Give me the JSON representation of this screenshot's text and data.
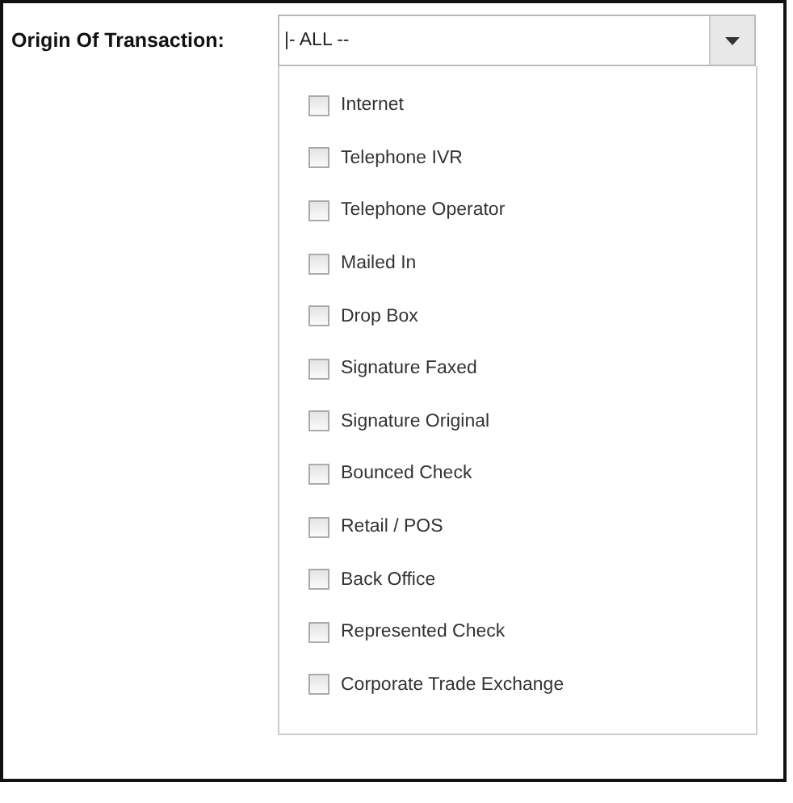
{
  "field": {
    "label": "Origin Of Transaction:",
    "value": "|- ALL --",
    "expanded": true
  },
  "options": [
    {
      "label": "Internet",
      "checked": false
    },
    {
      "label": "Telephone IVR",
      "checked": false
    },
    {
      "label": "Telephone Operator",
      "checked": false
    },
    {
      "label": "Mailed In",
      "checked": false
    },
    {
      "label": "Drop Box",
      "checked": false
    },
    {
      "label": "Signature Faxed",
      "checked": false
    },
    {
      "label": "Signature Original",
      "checked": false
    },
    {
      "label": "Bounced Check",
      "checked": false
    },
    {
      "label": "Retail / POS",
      "checked": false
    },
    {
      "label": "Back Office",
      "checked": false
    },
    {
      "label": "Represented Check",
      "checked": false
    },
    {
      "label": "Corporate Trade Exchange",
      "checked": false
    }
  ]
}
